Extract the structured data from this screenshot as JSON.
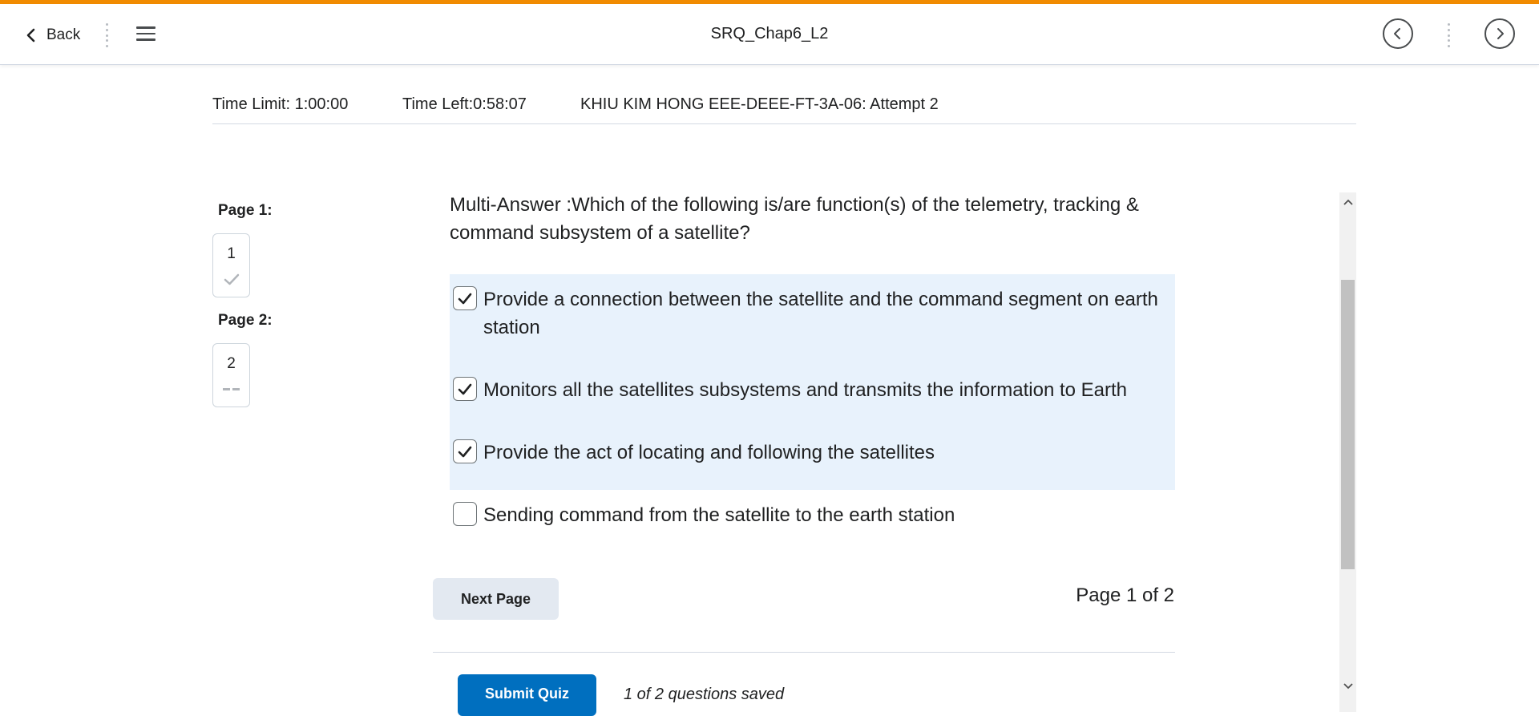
{
  "navbar": {
    "back_label": "Back",
    "title": "SRQ_Chap6_L2",
    "accent_color": "#f18b00"
  },
  "quiz_info": {
    "time_limit": "Time Limit: 1:00:00",
    "time_left": "Time Left:0:58:07",
    "attempt": "KHIU KIM HONG EEE-DEEE-FT-3A-06: Attempt 2"
  },
  "pages": [
    {
      "label": "Page 1:",
      "number": "1",
      "status_icon": "check-icon"
    },
    {
      "label": "Page 2:",
      "number": "2",
      "status_icon": "dash-icon"
    }
  ],
  "question": {
    "text": "Multi-Answer :Which of the following is/are function(s) of the telemetry, tracking & command subsystem of a satellite?",
    "answers": [
      {
        "text": "Provide a connection between the satellite and the command segment on earth station",
        "checked": true
      },
      {
        "text": "Monitors all the satellites subsystems and transmits the information to Earth",
        "checked": true
      },
      {
        "text": "Provide the act of locating and following the satellites",
        "checked": true
      },
      {
        "text": "Sending command from the satellite to the earth station",
        "checked": false
      }
    ],
    "selected_bg_color": "#e8f2fc"
  },
  "footer": {
    "next_page_label": "Next Page",
    "page_indicator": "Page 1 of 2",
    "submit_label": "Submit Quiz",
    "answered_status": "1 of 2 questions saved",
    "submit_color": "#006fbf"
  }
}
